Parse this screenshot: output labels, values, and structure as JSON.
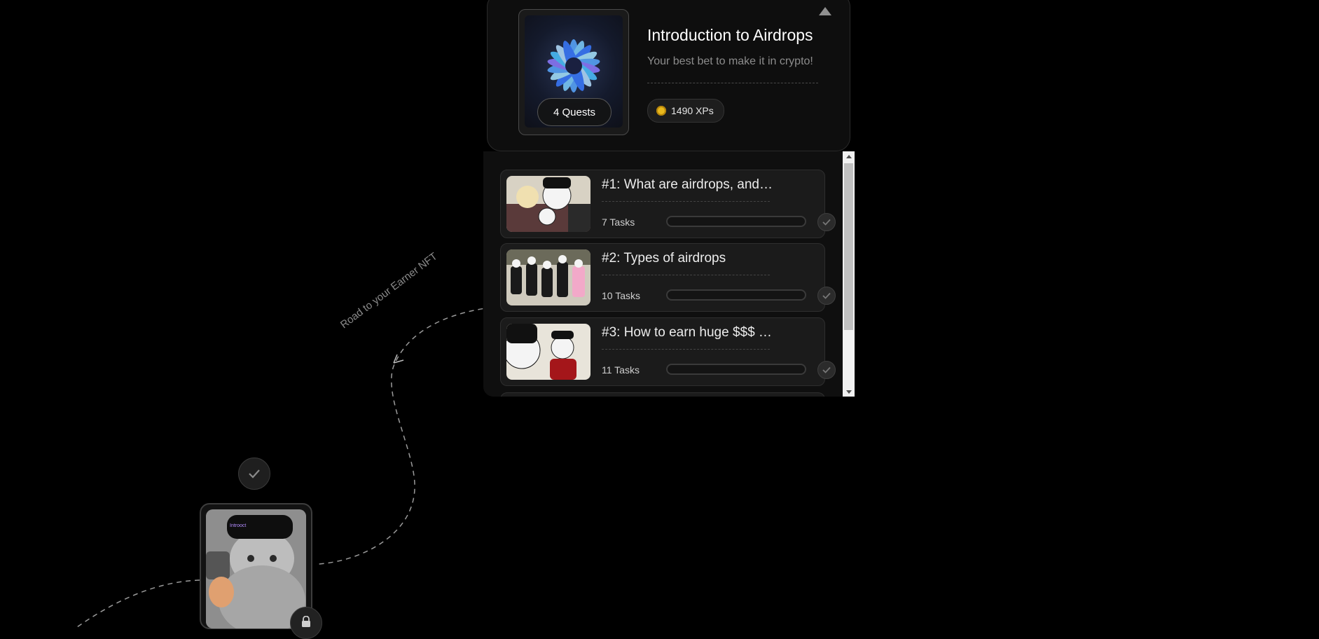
{
  "course": {
    "title": "Introduction to Airdrops",
    "subtitle": "Your best bet to make it in crypto!",
    "quests_label": "4 Quests",
    "xp_label": "1490 XPs"
  },
  "quests": [
    {
      "title": "#1: What are airdrops, and…",
      "tasks": "7 Tasks",
      "progress": 0
    },
    {
      "title": "#2: Types of airdrops",
      "tasks": "10 Tasks",
      "progress": 0
    },
    {
      "title": "#3: How to earn huge $$$ …",
      "tasks": "11 Tasks",
      "progress": 0
    }
  ],
  "road": {
    "label": "Road to your Earner NFT"
  },
  "nft": {
    "tag": "Introoct"
  },
  "colors": {
    "background": "#000000",
    "card": "#0e0e0e",
    "coin": "#e9b91d",
    "progress": "#7b61ff"
  }
}
